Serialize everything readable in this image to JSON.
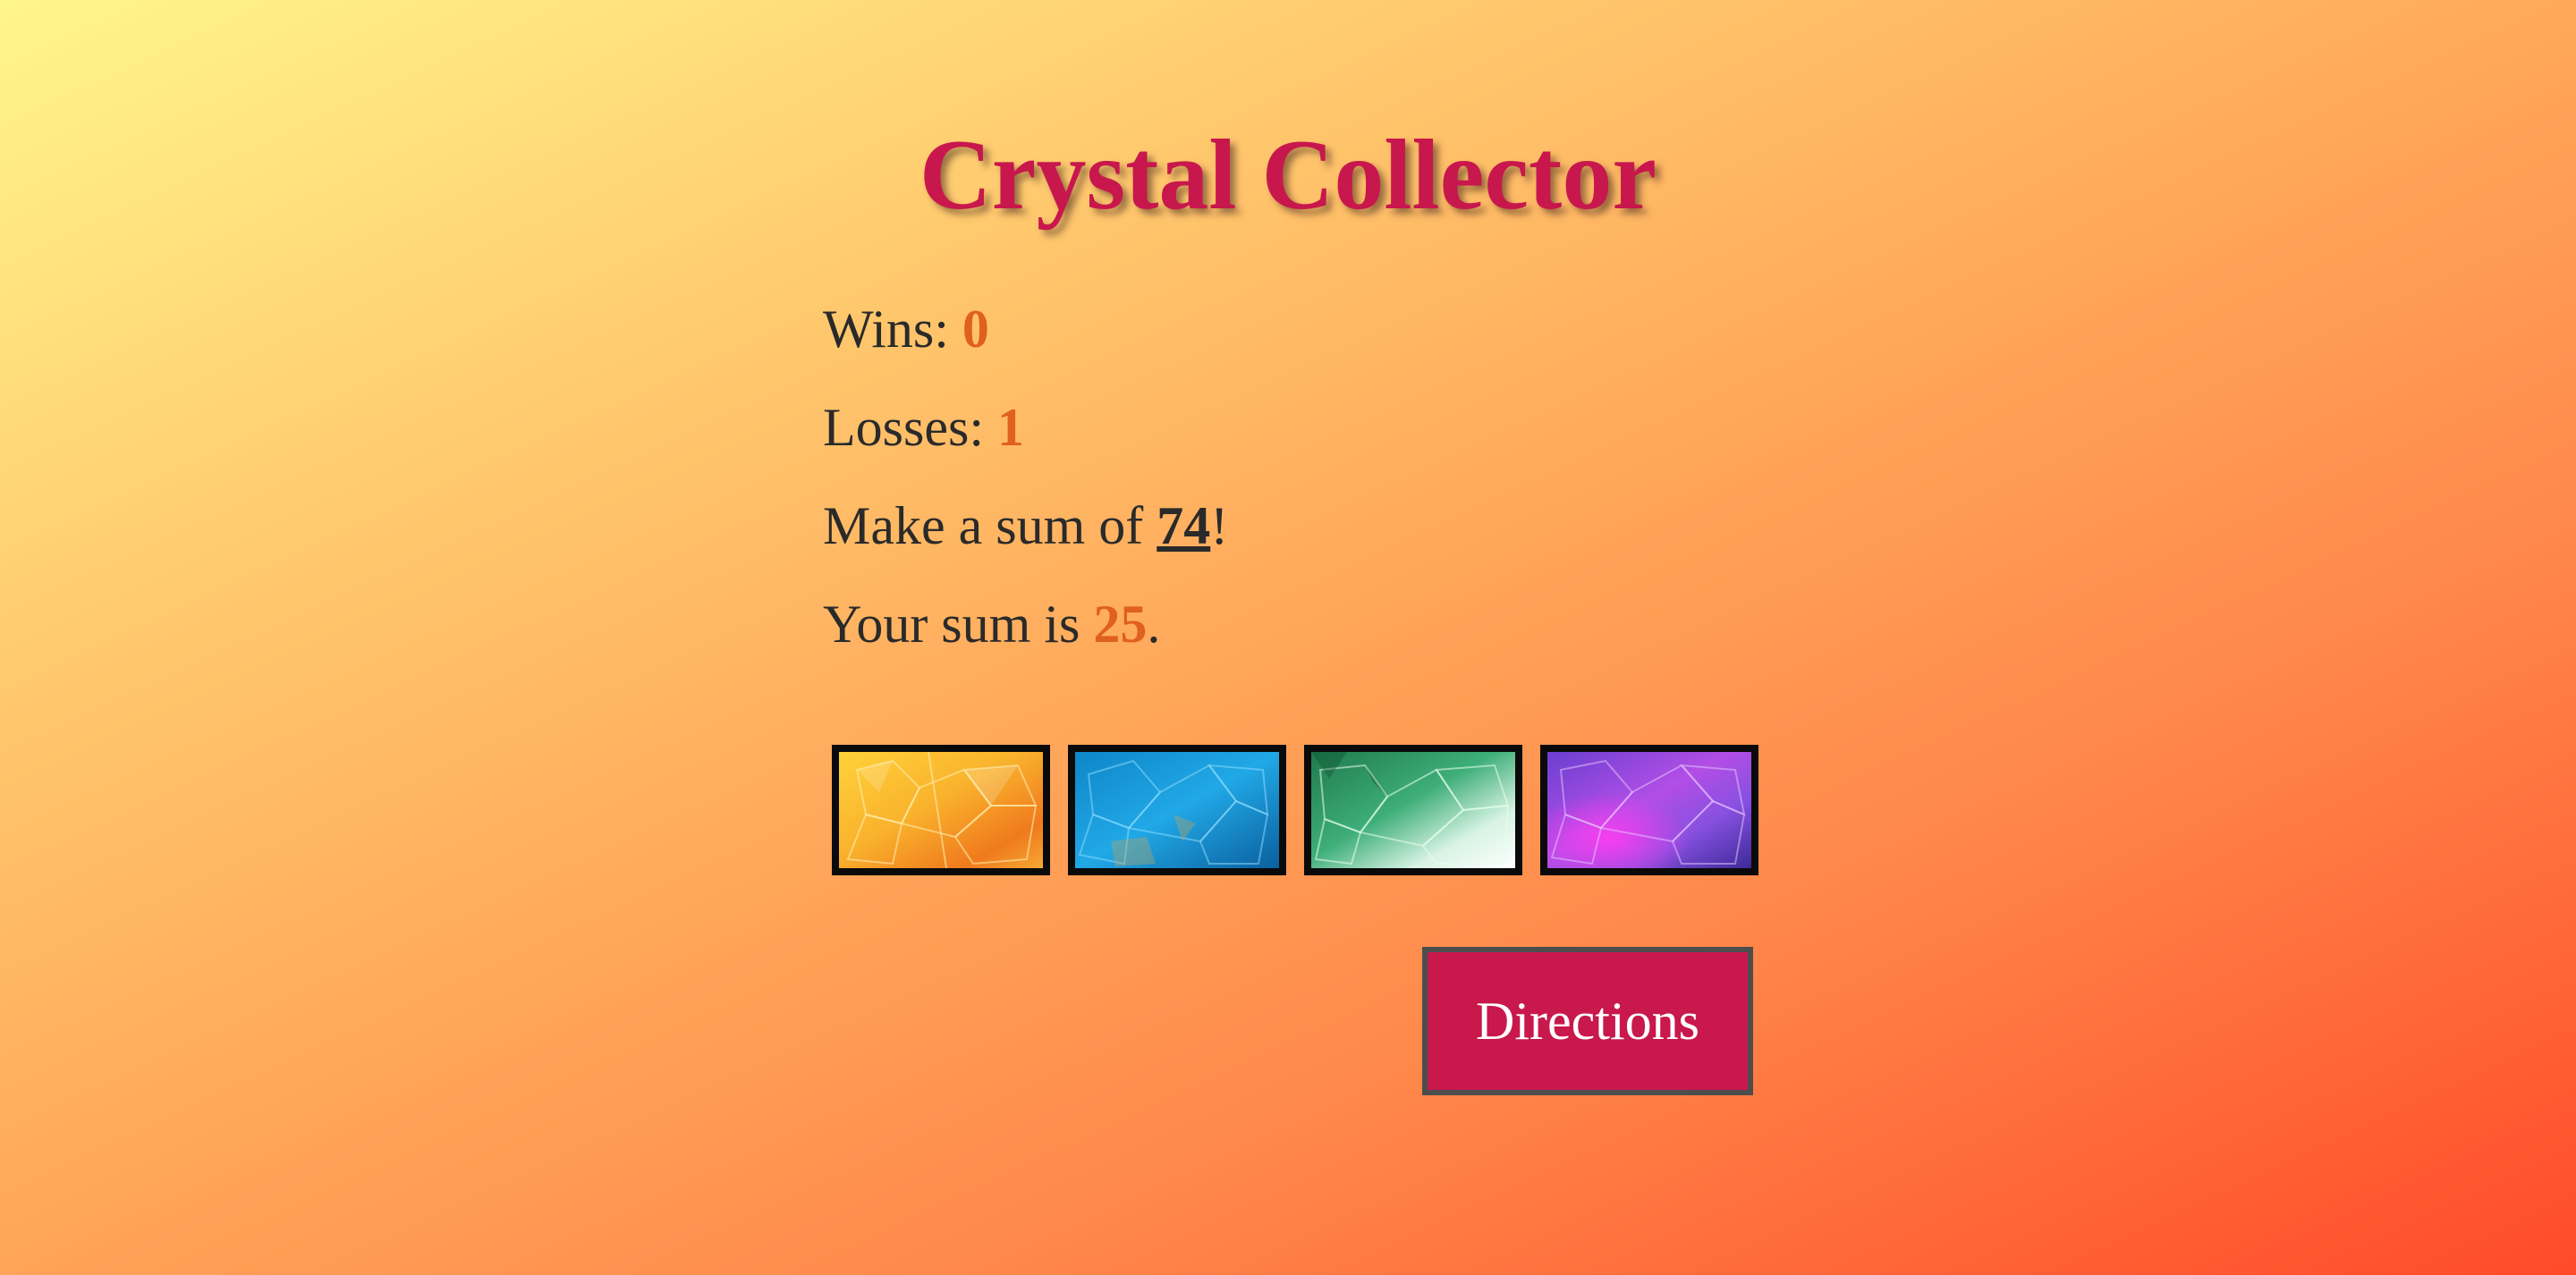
{
  "title": "Crystal Collector",
  "stats": {
    "wins_label": "Wins: ",
    "wins_value": "0",
    "losses_label": "Losses: ",
    "losses_value": "1",
    "target_prefix": "Make a sum of ",
    "target_value": "74",
    "target_suffix": "!",
    "sum_prefix": "Your sum is ",
    "sum_value": "25",
    "sum_suffix": "."
  },
  "crystals": [
    {
      "name": "orange crystal",
      "color": "#f7a52b"
    },
    {
      "name": "blue crystal",
      "color": "#1a9ad6"
    },
    {
      "name": "green crystal",
      "color": "#2f9a6a"
    },
    {
      "name": "purple crystal",
      "color": "#9a46d8"
    }
  ],
  "directions_button": "Directions",
  "colors": {
    "title": "#c8174d",
    "value": "#e0601e",
    "button_bg": "#c8184c"
  }
}
